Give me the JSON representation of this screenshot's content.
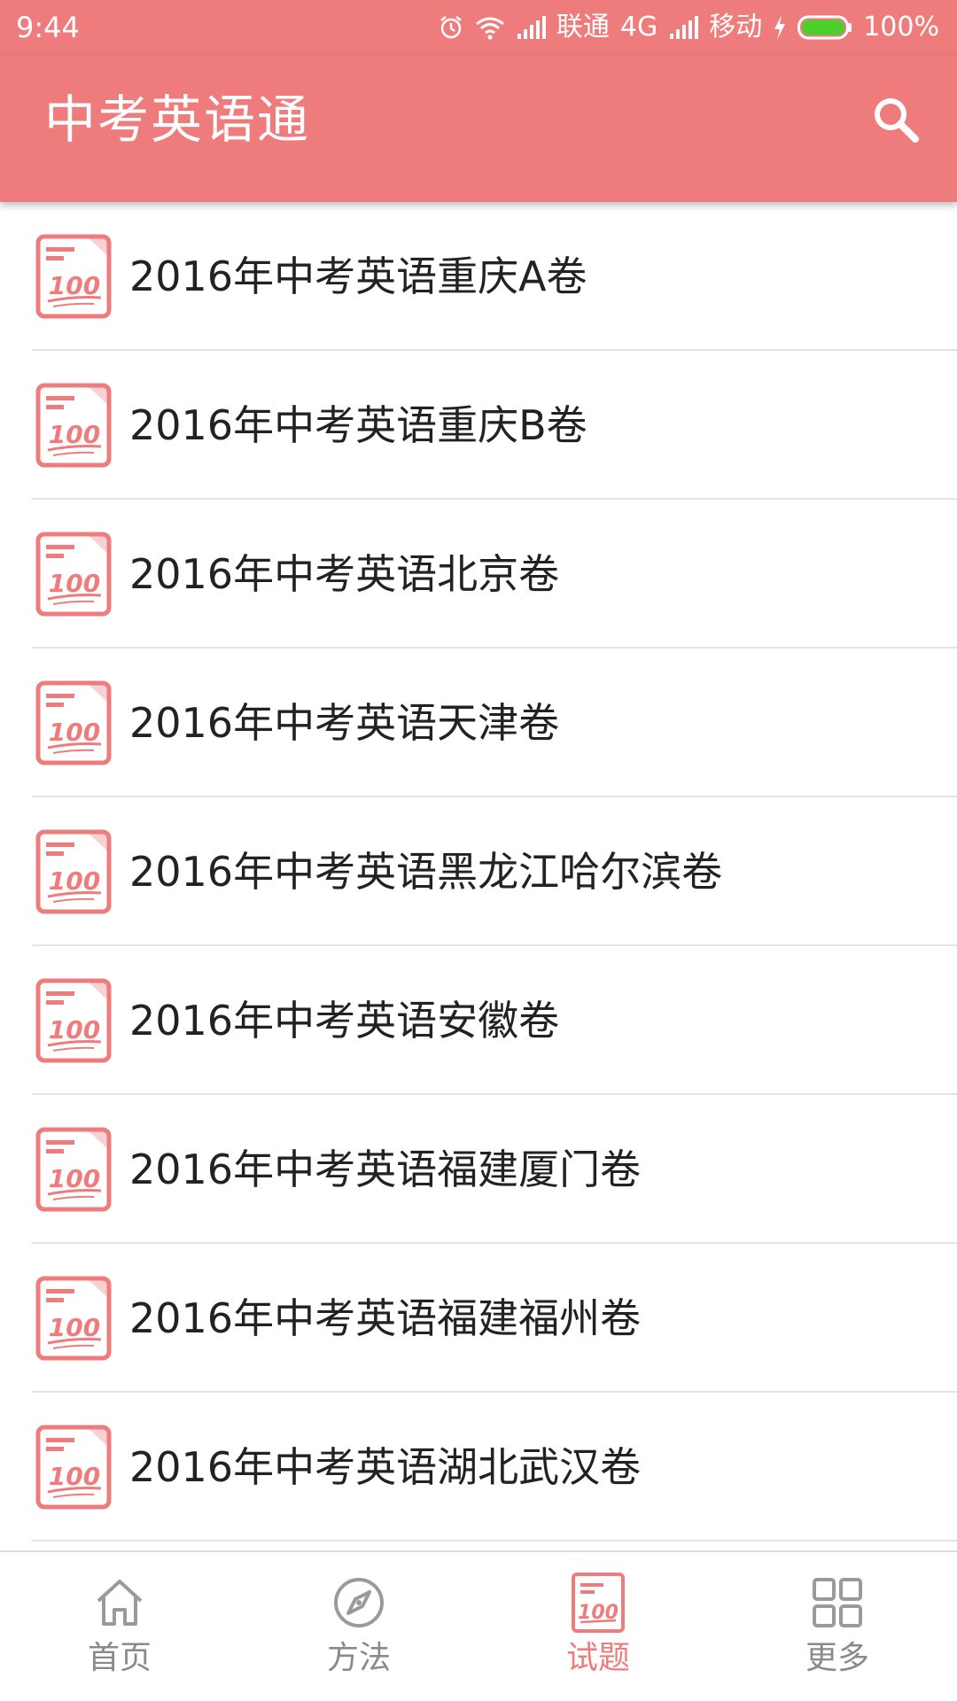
{
  "status_bar": {
    "time": "9:44",
    "carrier1": "联通",
    "network": "4G",
    "carrier2": "移动",
    "battery": "100%"
  },
  "app_bar": {
    "title": "中考英语通"
  },
  "papers": [
    {
      "label": "2016年中考英语重庆A卷"
    },
    {
      "label": "2016年中考英语重庆B卷"
    },
    {
      "label": "2016年中考英语北京卷"
    },
    {
      "label": "2016年中考英语天津卷"
    },
    {
      "label": "2016年中考英语黑龙江哈尔滨卷"
    },
    {
      "label": "2016年中考英语安徽卷"
    },
    {
      "label": "2016年中考英语福建厦门卷"
    },
    {
      "label": "2016年中考英语福建福州卷"
    },
    {
      "label": "2016年中考英语湖北武汉卷"
    }
  ],
  "bottom_nav": {
    "items": [
      {
        "label": "首页",
        "icon": "home-icon"
      },
      {
        "label": "方法",
        "icon": "compass-icon"
      },
      {
        "label": "试题",
        "icon": "exam-100-icon"
      },
      {
        "label": "更多",
        "icon": "grid-icon"
      }
    ],
    "active_index": 2
  },
  "colors": {
    "accent": "#ef7c7d",
    "text": "#222222",
    "nav_inactive": "#8a8a8a",
    "divider": "#e3e3e3"
  }
}
